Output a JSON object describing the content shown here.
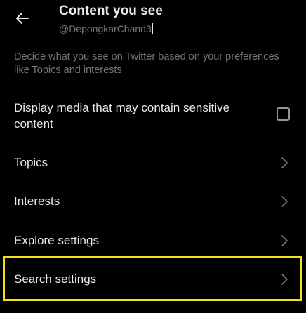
{
  "header": {
    "title": "Content you see",
    "handle": "@DepongkarChand3",
    "back_icon": "arrow-left-icon"
  },
  "description": "Decide what you see on Twitter based on your preferences like Topics and interests",
  "sensitive_media": {
    "label": "Display media that may contain sensitive content",
    "checked": false
  },
  "nav_items": [
    {
      "label": "Topics"
    },
    {
      "label": "Interests"
    },
    {
      "label": "Explore settings"
    },
    {
      "label": "Search settings"
    }
  ],
  "colors": {
    "background": "#000000",
    "text_primary": "#e7e9ea",
    "text_secondary": "#71767b",
    "chevron": "#71767b",
    "highlight": "#f2e01b"
  }
}
